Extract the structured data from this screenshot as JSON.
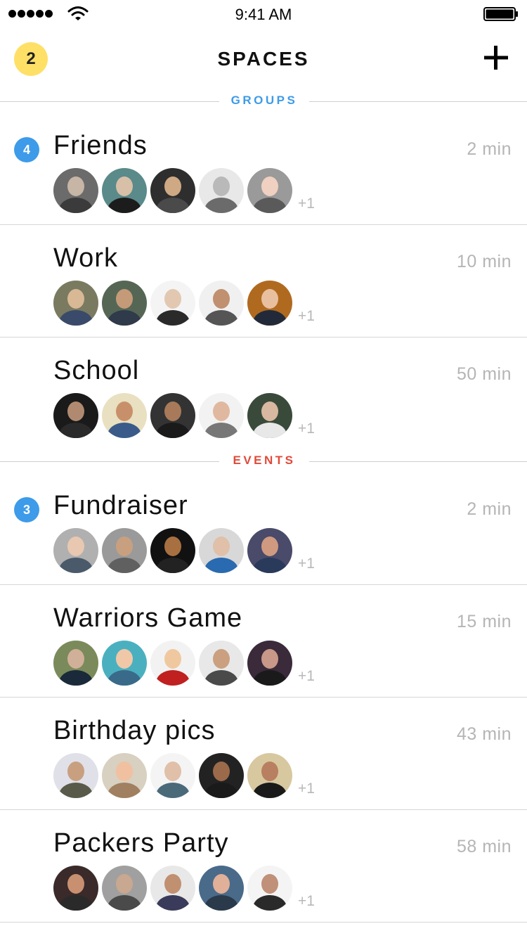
{
  "status_bar": {
    "time": "9:41 AM"
  },
  "header": {
    "title": "SPACES",
    "notification_count": "2"
  },
  "colors": {
    "groups": "#3d9be9",
    "events": "#e04a3a",
    "badge_yellow": "#ffe066",
    "badge_blue": "#3d9be9"
  },
  "sections": [
    {
      "label": "GROUPS",
      "items": [
        {
          "name": "Friends",
          "time": "2 min",
          "unread": "4",
          "more": "+1",
          "avatars": [
            [
              "#6b6b6b",
              "#c7b5a5",
              "#3b3b3b"
            ],
            [
              "#5a8a8a",
              "#d8bfa8",
              "#1c1c1c"
            ],
            [
              "#2e2e2e",
              "#cfa884",
              "#4a4a4a"
            ],
            [
              "#e8e8e8",
              "#b9b9b9",
              "#6b6b6b"
            ],
            [
              "#9a9a9a",
              "#f0d0c0",
              "#5a5a5a"
            ]
          ]
        },
        {
          "name": "Work",
          "time": "10 min",
          "unread": "",
          "more": "+1",
          "avatars": [
            [
              "#7a7a60",
              "#d9b896",
              "#3a4a6a"
            ],
            [
              "#556655",
              "#c49a78",
              "#2f3a4a"
            ],
            [
              "#f4f4f4",
              "#e2c8b0",
              "#2a2a2a"
            ],
            [
              "#f0f0f0",
              "#c09070",
              "#555555"
            ],
            [
              "#b06a20",
              "#e8c0a0",
              "#222a3a"
            ]
          ]
        },
        {
          "name": "School",
          "time": "50 min",
          "unread": "",
          "more": "+1",
          "avatars": [
            [
              "#1a1a1a",
              "#b08a70",
              "#2a2a2a"
            ],
            [
              "#e8e0c0",
              "#c8906a",
              "#3a5a8a"
            ],
            [
              "#333333",
              "#a87a5a",
              "#1a1a1a"
            ],
            [
              "#f2f2f2",
              "#e0b8a0",
              "#777777"
            ],
            [
              "#3a4a3a",
              "#d8b8a0",
              "#e8e8e8"
            ]
          ]
        }
      ]
    },
    {
      "label": "EVENTS",
      "items": [
        {
          "name": "Fundraiser",
          "time": "2 min",
          "unread": "3",
          "more": "+1",
          "avatars": [
            [
              "#b0b0b0",
              "#e8c8b0",
              "#4a5a6a"
            ],
            [
              "#9a9a9a",
              "#c8a080",
              "#606060"
            ],
            [
              "#111111",
              "#a87040",
              "#222222"
            ],
            [
              "#d8d8d8",
              "#e0c0a8",
              "#2a6ab0"
            ],
            [
              "#4a4a6a",
              "#d09a80",
              "#2a3a5a"
            ]
          ]
        },
        {
          "name": "Warriors Game",
          "time": "15 min",
          "unread": "",
          "more": "+1",
          "avatars": [
            [
              "#7a8a5a",
              "#d0b098",
              "#1a2a3a"
            ],
            [
              "#4ab0c0",
              "#f0c8a8",
              "#3a6a8a"
            ],
            [
              "#f2f2f2",
              "#f0c8a0",
              "#c02020"
            ],
            [
              "#e8e8e8",
              "#caa080",
              "#4a4a4a"
            ],
            [
              "#3a2a3a",
              "#c89888",
              "#1a1a1a"
            ]
          ]
        },
        {
          "name": "Birthday pics",
          "time": "43 min",
          "unread": "",
          "more": "+1",
          "avatars": [
            [
              "#e0e0e8",
              "#c8a080",
              "#5a5a4a"
            ],
            [
              "#d8d0c0",
              "#f0c0a0",
              "#a08060"
            ],
            [
              "#f4f4f4",
              "#e0c0a8",
              "#4a6a7a"
            ],
            [
              "#222222",
              "#9a6a4a",
              "#1a1a1a"
            ],
            [
              "#d8c8a0",
              "#b88060",
              "#1a1a1a"
            ]
          ]
        },
        {
          "name": "Packers Party",
          "time": "58 min",
          "unread": "",
          "more": "+1",
          "avatars": [
            [
              "#3a2a2a",
              "#c89070",
              "#2a2a2a"
            ],
            [
              "#a0a0a0",
              "#c8a890",
              "#4a4a4a"
            ],
            [
              "#e8e8e8",
              "#c09070",
              "#3a3a5a"
            ],
            [
              "#4a6a8a",
              "#e0b098",
              "#2a3a4a"
            ],
            [
              "#f4f4f4",
              "#c09078",
              "#2a2a2a"
            ]
          ]
        }
      ]
    }
  ]
}
